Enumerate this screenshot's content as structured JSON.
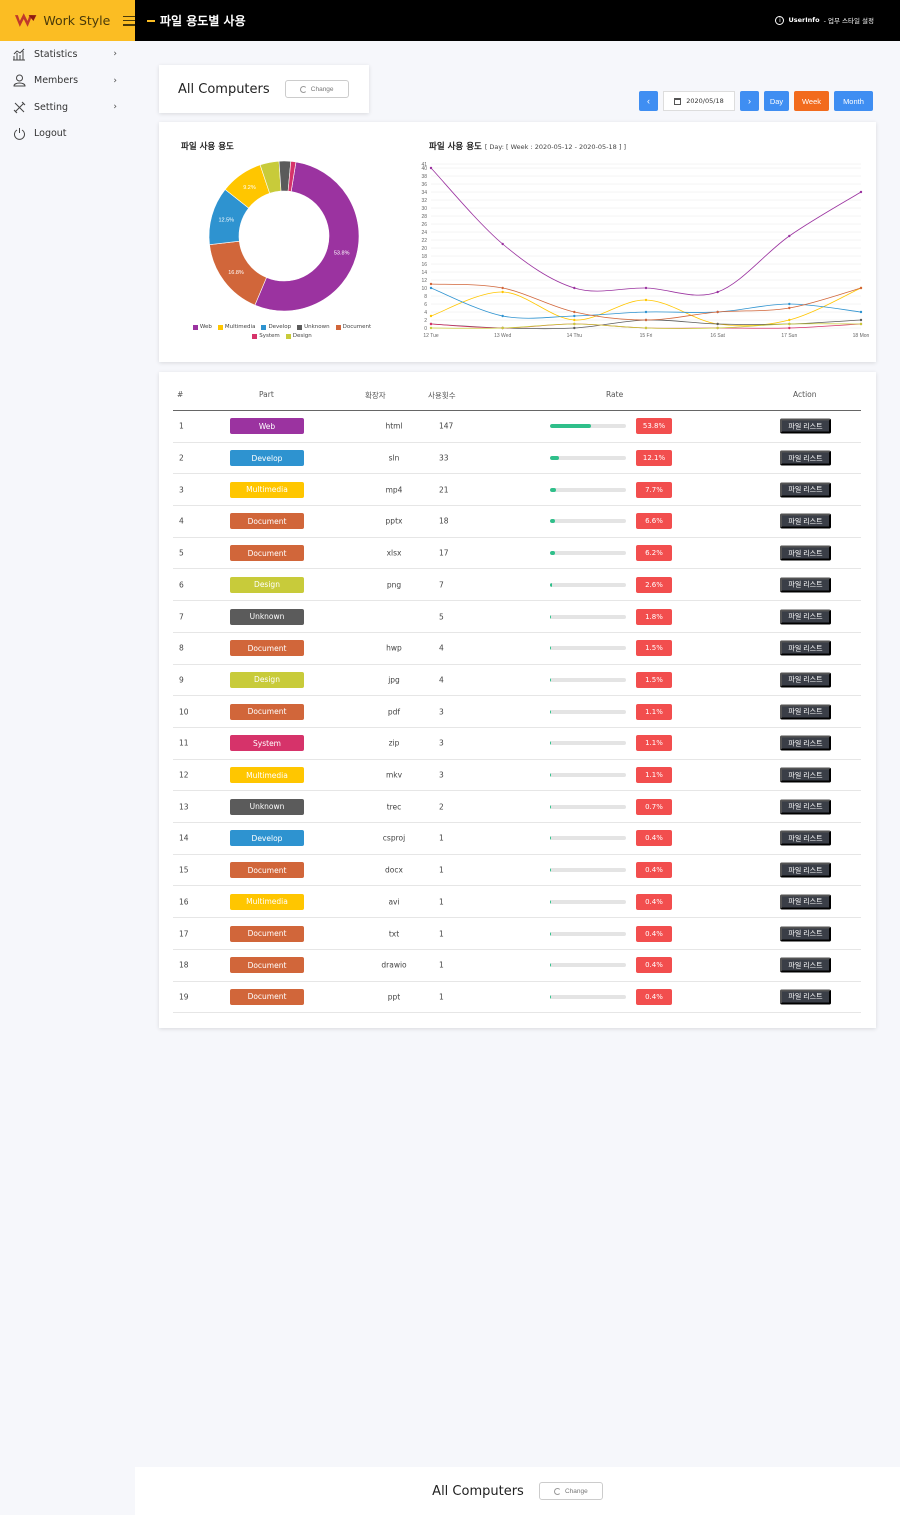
{
  "brand": {
    "name": "Work Style"
  },
  "header": {
    "title": "파일 용도별 사용",
    "userinfo_bold": "UserInfo",
    "userinfo_rest": " - 업무 스타일 설정"
  },
  "sidebar": {
    "items": [
      {
        "label": "Statistics",
        "icon": "chart-icon"
      },
      {
        "label": "Members",
        "icon": "user-icon"
      },
      {
        "label": "Setting",
        "icon": "tools-icon"
      },
      {
        "label": "Logout",
        "icon": "power-icon"
      }
    ]
  },
  "selector": {
    "title": "All Computers",
    "change_label": "Change"
  },
  "nav": {
    "prev": "‹",
    "date": "2020/05/18",
    "next": "›",
    "day": "Day",
    "week": "Week",
    "month": "Month"
  },
  "colors": {
    "Web": "#9b33a0",
    "Multimedia": "#ffc600",
    "Develop": "#2e93d0",
    "Unknown": "#5b5b5b",
    "Document": "#d1663a",
    "System": "#d6336a",
    "Design": "#c8cb3a"
  },
  "donut": {
    "title": "파일 사용 용도",
    "slices": [
      {
        "name": "Web",
        "value": 53.8,
        "label": "53.8%"
      },
      {
        "name": "Document",
        "value": 16.8,
        "label": "16.8%"
      },
      {
        "name": "Develop",
        "value": 12.5,
        "label": "12.5%"
      },
      {
        "name": "Multimedia",
        "value": 9.2,
        "label": "9.2%"
      },
      {
        "name": "Design",
        "value": 4.1,
        "label": ""
      },
      {
        "name": "Unknown",
        "value": 2.5,
        "label": ""
      },
      {
        "name": "System",
        "value": 1.1,
        "label": ""
      }
    ],
    "legend": [
      "Web",
      "Multimedia",
      "Develop",
      "Unknown",
      "Document",
      "System",
      "Design"
    ]
  },
  "line": {
    "title": "파일 사용 용도",
    "subtitle": "[ Day: [ Week : 2020-05-12 - 2020-05-18 ] ]"
  },
  "chart_data": {
    "type": "line",
    "x": [
      "12 Tue",
      "13 Wed",
      "14 Thu",
      "15 Fri",
      "16 Sat",
      "17 Sun",
      "18 Mon"
    ],
    "ylim": [
      0,
      41
    ],
    "yticks": [
      0,
      2,
      4,
      6,
      8,
      10,
      12,
      14,
      16,
      18,
      20,
      22,
      24,
      26,
      28,
      30,
      32,
      34,
      36,
      38,
      40,
      41
    ],
    "series": [
      {
        "name": "Web",
        "values": [
          40,
          21,
          10,
          10,
          9,
          23,
          34
        ]
      },
      {
        "name": "Multimedia",
        "values": [
          3,
          9,
          2,
          7,
          1,
          2,
          10
        ]
      },
      {
        "name": "Develop",
        "values": [
          10,
          3,
          3,
          4,
          4,
          6,
          4
        ]
      },
      {
        "name": "Unknown",
        "values": [
          1,
          0,
          0,
          2,
          1,
          1,
          2
        ]
      },
      {
        "name": "Document",
        "values": [
          11,
          10,
          4,
          2,
          4,
          5,
          10
        ]
      },
      {
        "name": "System",
        "values": [
          1,
          0,
          1,
          0,
          0,
          0,
          1
        ]
      },
      {
        "name": "Design",
        "values": [
          0,
          0,
          1,
          0,
          0,
          1,
          1
        ]
      }
    ]
  },
  "table": {
    "headers": [
      "#",
      "Part",
      "확장자",
      "사용횟수",
      "Rate",
      "Action"
    ],
    "action_label": "파일 리스트",
    "rows": [
      {
        "no": "1",
        "part": "Web",
        "ext": "html",
        "count": "147",
        "rate": 53.8,
        "rate_label": "53.8%"
      },
      {
        "no": "2",
        "part": "Develop",
        "ext": "sln",
        "count": "33",
        "rate": 12.1,
        "rate_label": "12.1%"
      },
      {
        "no": "3",
        "part": "Multimedia",
        "ext": "mp4",
        "count": "21",
        "rate": 7.7,
        "rate_label": "7.7%"
      },
      {
        "no": "4",
        "part": "Document",
        "ext": "pptx",
        "count": "18",
        "rate": 6.6,
        "rate_label": "6.6%"
      },
      {
        "no": "5",
        "part": "Document",
        "ext": "xlsx",
        "count": "17",
        "rate": 6.2,
        "rate_label": "6.2%"
      },
      {
        "no": "6",
        "part": "Design",
        "ext": "png",
        "count": "7",
        "rate": 2.6,
        "rate_label": "2.6%"
      },
      {
        "no": "7",
        "part": "Unknown",
        "ext": "",
        "count": "5",
        "rate": 1.8,
        "rate_label": "1.8%"
      },
      {
        "no": "8",
        "part": "Document",
        "ext": "hwp",
        "count": "4",
        "rate": 1.5,
        "rate_label": "1.5%"
      },
      {
        "no": "9",
        "part": "Design",
        "ext": "jpg",
        "count": "4",
        "rate": 1.5,
        "rate_label": "1.5%"
      },
      {
        "no": "10",
        "part": "Document",
        "ext": "pdf",
        "count": "3",
        "rate": 1.1,
        "rate_label": "1.1%"
      },
      {
        "no": "11",
        "part": "System",
        "ext": "zip",
        "count": "3",
        "rate": 1.1,
        "rate_label": "1.1%"
      },
      {
        "no": "12",
        "part": "Multimedia",
        "ext": "mkv",
        "count": "3",
        "rate": 1.1,
        "rate_label": "1.1%"
      },
      {
        "no": "13",
        "part": "Unknown",
        "ext": "trec",
        "count": "2",
        "rate": 0.7,
        "rate_label": "0.7%"
      },
      {
        "no": "14",
        "part": "Develop",
        "ext": "csproj",
        "count": "1",
        "rate": 0.4,
        "rate_label": "0.4%"
      },
      {
        "no": "15",
        "part": "Document",
        "ext": "docx",
        "count": "1",
        "rate": 0.4,
        "rate_label": "0.4%"
      },
      {
        "no": "16",
        "part": "Multimedia",
        "ext": "avi",
        "count": "1",
        "rate": 0.4,
        "rate_label": "0.4%"
      },
      {
        "no": "17",
        "part": "Document",
        "ext": "txt",
        "count": "1",
        "rate": 0.4,
        "rate_label": "0.4%"
      },
      {
        "no": "18",
        "part": "Document",
        "ext": "drawio",
        "count": "1",
        "rate": 0.4,
        "rate_label": "0.4%"
      },
      {
        "no": "19",
        "part": "Document",
        "ext": "ppt",
        "count": "1",
        "rate": 0.4,
        "rate_label": "0.4%"
      }
    ]
  },
  "footer": {
    "title": "All Computers",
    "change_label": "Change"
  }
}
